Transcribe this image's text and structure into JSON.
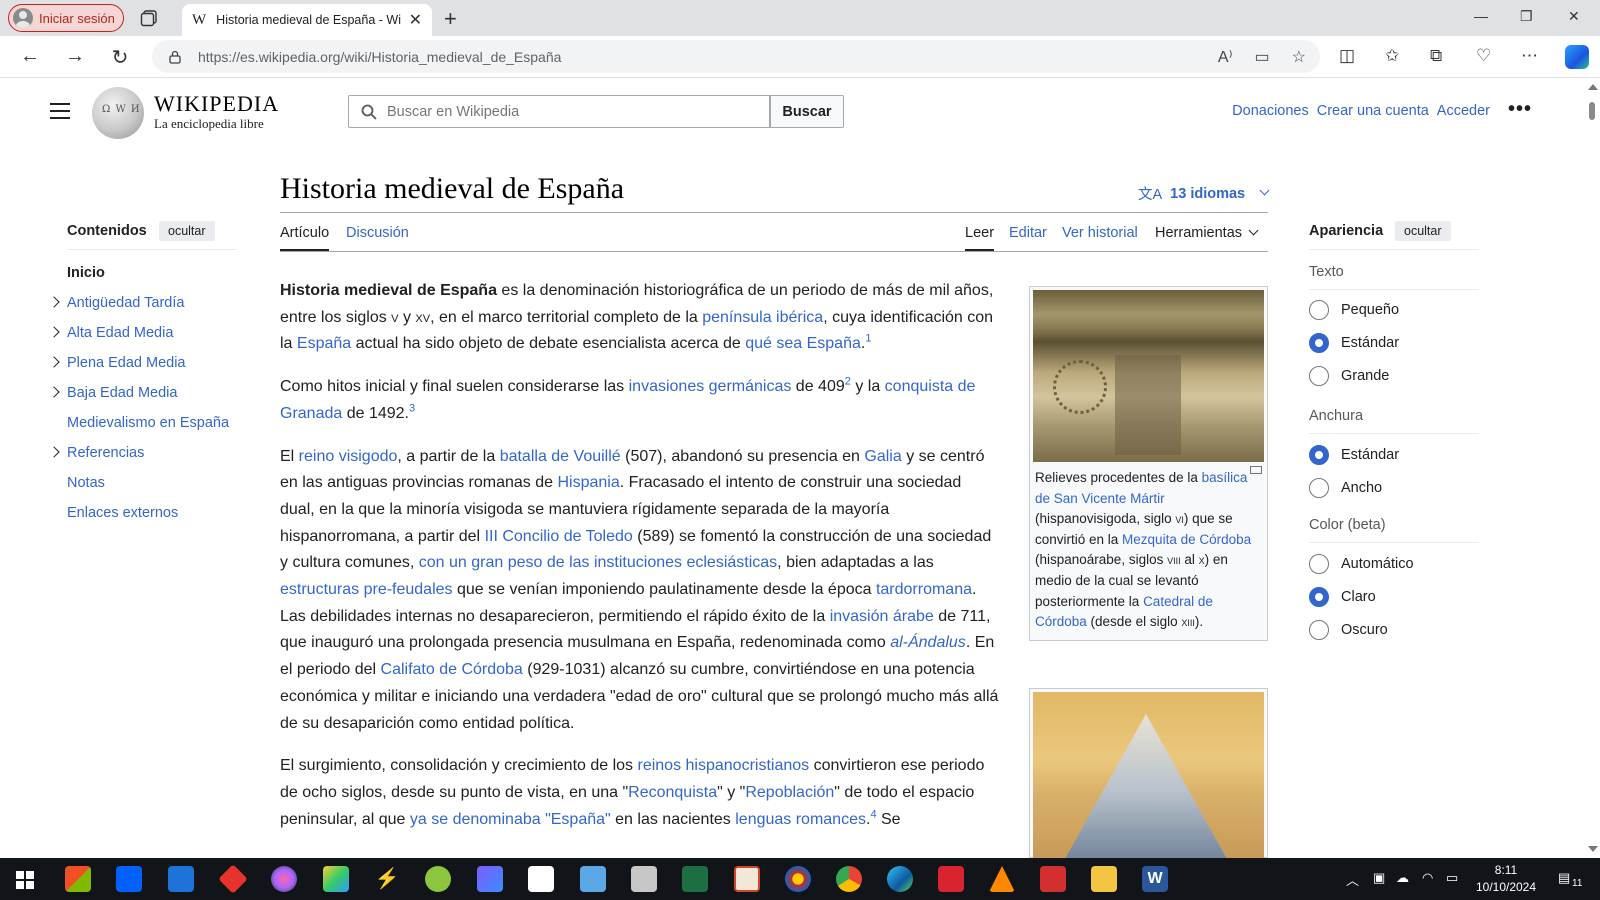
{
  "browser": {
    "profile_label": "Iniciar sesión",
    "tab_title": "Historia medieval de España - Wikipedia",
    "url": "https://es.wikipedia.org/wiki/Historia_medieval_de_España"
  },
  "header": {
    "wordmark": "WIKIPEDIA",
    "tagline": "La enciclopedia libre",
    "search_placeholder": "Buscar en Wikipedia",
    "search_button": "Buscar",
    "links": [
      "Donaciones",
      "Crear una cuenta",
      "Acceder"
    ]
  },
  "toc": {
    "title": "Contenidos",
    "hide_label": "ocultar",
    "items": [
      {
        "label": "Inicio",
        "expandable": false
      },
      {
        "label": "Antigüedad Tardía",
        "expandable": true
      },
      {
        "label": "Alta Edad Media",
        "expandable": true
      },
      {
        "label": "Plena Edad Media",
        "expandable": true
      },
      {
        "label": "Baja Edad Media",
        "expandable": true
      },
      {
        "label": "Medievalismo en España",
        "expandable": false
      },
      {
        "label": "Referencias",
        "expandable": true
      },
      {
        "label": "Notas",
        "expandable": false
      },
      {
        "label": "Enlaces externos",
        "expandable": false
      }
    ]
  },
  "article": {
    "title": "Historia medieval de España",
    "languages": "13 idiomas",
    "tabs": {
      "article": "Artículo",
      "talk": "Discusión",
      "read": "Leer",
      "edit": "Editar",
      "history": "Ver historial",
      "tools": "Herramientas"
    },
    "p1": {
      "b": "Historia medieval de España",
      "t1": " es la denominación historiográfica de un periodo de más de mil años, entre los siglos ",
      "s1": "v",
      "t2": " y ",
      "s2": "xv",
      "t3": ", en el marco territorial completo de la ",
      "l1": "península ibérica",
      "t4": ", cuya identificación con la ",
      "l2": "España",
      "t5": " actual ha sido objeto de debate esencialista acerca de ",
      "l3": "qué sea España",
      "t6": ".",
      "r1": "1"
    },
    "p2": {
      "t1": "Como hitos inicial y final suelen considerarse las ",
      "l1": "invasiones germánicas",
      "t2": " de 409",
      "r1": "2",
      "t3": "  y la ",
      "l2": "conquista de Granada",
      "t4": " de 1492.",
      "r2": "3"
    },
    "p3": {
      "t1": "El ",
      "l1": "reino visigodo",
      "t2": ", a partir de la ",
      "l2": "batalla de Vouillé",
      "t3": " (507), abandonó su presencia en ",
      "l3": "Galia",
      "t4": " y se centró en las antiguas provincias romanas de ",
      "l4": "Hispania",
      "t5": ". Fracasado el intento de construir una sociedad dual, en la que la minoría visigoda se mantuviera rígidamente separada de la mayoría hispanorromana, a partir del ",
      "l5": "III Concilio de Toledo",
      "t6": " (589) se fomentó la construcción de una sociedad y cultura comunes, ",
      "l6": "con un gran peso de las instituciones eclesiásticas",
      "t7": ", bien adaptadas a las ",
      "l7": "estructuras pre-feudales",
      "t8": " que se venían imponiendo paulatinamente desde la época ",
      "l8": "tardorromana",
      "t9": ". Las debilidades internas no desaparecieron, permitiendo el rápido éxito de la ",
      "l9": "invasión árabe",
      "t10": " de 711, que inauguró una prolongada presencia musulmana en España, redenominada como ",
      "l10": "al-Ándalus",
      "t11": ". En el periodo del ",
      "l11": "Califato de Córdoba",
      "t12": " (929-1031) alcanzó su cumbre, convirtiéndose en una potencia económica y militar e iniciando una verdadera \"edad de oro\" cultural que se prolongó mucho más allá de su desaparición como entidad política."
    },
    "p4": {
      "t1": "El surgimiento, consolidación y crecimiento de los ",
      "l1": "reinos hispanocristianos",
      "t2": " convirtieron ese periodo de ocho siglos, desde su punto de vista, en una \"",
      "l2": "Reconquista",
      "t3": "\" y \"",
      "l3": "Repoblación",
      "t4": "\" de todo el espacio peninsular, al que ",
      "l4": "ya se denominaba \"España\"",
      "t5": " en las nacientes ",
      "l5": "lenguas romances",
      "t6": ".",
      "r1": "4",
      "t7": "  Se"
    },
    "caption": {
      "t1": "Relieves procedentes de la ",
      "l1": "basílica de San Vicente Mártir",
      "t2": " (hispanovisigoda, siglo ",
      "s1": "vi",
      "t3": ") que se convirtió en la ",
      "l2": "Mezquita de Córdoba",
      "t4": " (hispanoárabe, siglos ",
      "s2": "viii",
      "t5": " al ",
      "s3": "x",
      "t6": ") en medio de la cual se levantó posteriormente la ",
      "l3": "Catedral de Córdoba",
      "t7": " (desde el siglo ",
      "s4": "xiii",
      "t8": ")."
    }
  },
  "appearance": {
    "title": "Apariencia",
    "hide_label": "ocultar",
    "text_label": "Texto",
    "text_options": [
      "Pequeño",
      "Estándar",
      "Grande"
    ],
    "width_label": "Anchura",
    "width_options": [
      "Estándar",
      "Ancho"
    ],
    "color_label": "Color (beta)",
    "color_options": [
      "Automático",
      "Claro",
      "Oscuro"
    ]
  },
  "taskbar": {
    "time": "8:11",
    "date": "10/10/2024",
    "notif_count": "11"
  }
}
